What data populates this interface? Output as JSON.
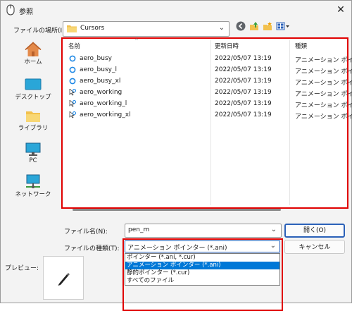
{
  "window": {
    "title": "参照",
    "close_glyph": "✕"
  },
  "location": {
    "label": "ファイルの場所(I):",
    "value": "Cursors"
  },
  "places": [
    {
      "label": "ホーム",
      "icon": "home-icon"
    },
    {
      "label": "デスクトップ",
      "icon": "desktop-icon"
    },
    {
      "label": "ライブラリ",
      "icon": "library-icon"
    },
    {
      "label": "PC",
      "icon": "pc-icon"
    },
    {
      "label": "ネットワーク",
      "icon": "network-icon"
    }
  ],
  "columns": {
    "name": "名前",
    "date": "更新日時",
    "type": "種類",
    "sort_glyph": "^"
  },
  "files": [
    {
      "name": "aero_busy",
      "date": "2022/05/07 13:19",
      "type": "アニメーション ポイン...",
      "icon": "busy-cursor-icon"
    },
    {
      "name": "aero_busy_l",
      "date": "2022/05/07 13:19",
      "type": "アニメーション ポイン...",
      "icon": "busy-cursor-icon"
    },
    {
      "name": "aero_busy_xl",
      "date": "2022/05/07 13:19",
      "type": "アニメーション ポイン...",
      "icon": "busy-cursor-icon"
    },
    {
      "name": "aero_working",
      "date": "2022/05/07 13:19",
      "type": "アニメーション ポイン...",
      "icon": "working-cursor-icon"
    },
    {
      "name": "aero_working_l",
      "date": "2022/05/07 13:19",
      "type": "アニメーション ポイン...",
      "icon": "working-cursor-icon"
    },
    {
      "name": "aero_working_xl",
      "date": "2022/05/07 13:19",
      "type": "アニメーション ポイン...",
      "icon": "working-cursor-icon"
    }
  ],
  "filename": {
    "label": "ファイル名(N):",
    "value": "pen_m"
  },
  "filetype": {
    "label": "ファイルの種類(T):",
    "selected": "アニメーション ポインター (*.ani)",
    "options": [
      "ポインター (*.ani, *.cur)",
      "アニメーション ポインター (*.ani)",
      "静的ポインター (*.cur)",
      "すべてのファイル"
    ]
  },
  "buttons": {
    "open": "開く(O)",
    "cancel": "キャンセル"
  },
  "preview": {
    "label": "プレビュー:"
  },
  "colors": {
    "highlight_border": "#e00000",
    "selection": "#0078d7",
    "focus": "#2b61b8"
  }
}
